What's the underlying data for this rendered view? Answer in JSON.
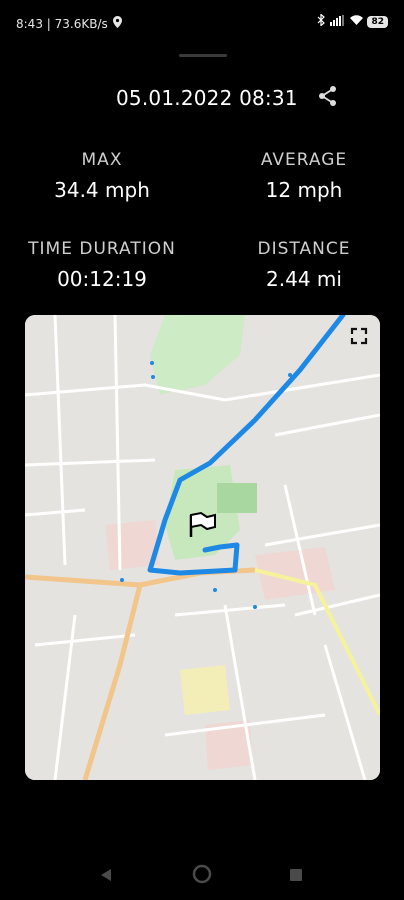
{
  "status": {
    "time_speed": "8:43 | 73.6KB/s",
    "battery": "82"
  },
  "header": {
    "datetime": "05.01.2022 08:31"
  },
  "stats": {
    "max": {
      "label": "MAX",
      "value": "34.4 mph"
    },
    "average": {
      "label": "AVERAGE",
      "value": "12 mph"
    },
    "time_duration": {
      "label": "TIME DURATION",
      "value": "00:12:19"
    },
    "distance": {
      "label": "DISTANCE",
      "value": "2.44 mi"
    }
  },
  "map": {
    "route_color": "#1e88e5",
    "icons": [
      "fullscreen-icon",
      "finish-flag-icon"
    ]
  },
  "nav": {
    "icons": [
      "back-icon",
      "home-icon",
      "recents-icon"
    ]
  }
}
